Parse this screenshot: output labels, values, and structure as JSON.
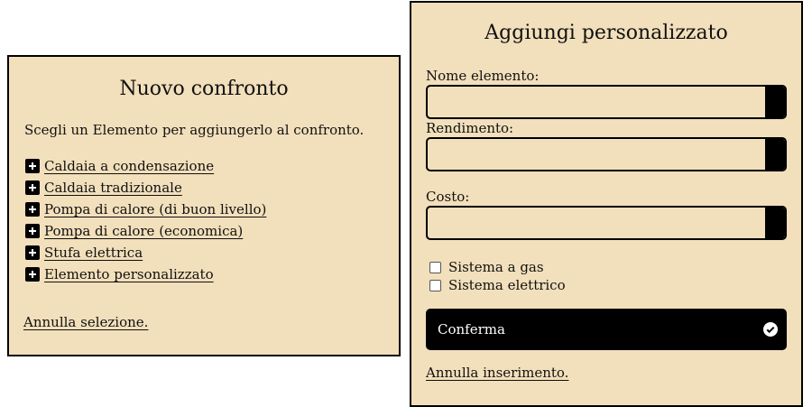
{
  "left_panel": {
    "title": "Nuovo confronto",
    "intro": "Scegli un Elemento per aggiungerlo al confronto.",
    "items": [
      {
        "label": "Caldaia a condensazione",
        "icon": "plus-icon"
      },
      {
        "label": "Caldaia tradizionale",
        "icon": "plus-icon"
      },
      {
        "label": "Pompa di calore (di buon livello)",
        "icon": "plus-icon"
      },
      {
        "label": "Pompa di calore (economica)",
        "icon": "plus-icon"
      },
      {
        "label": "Stufa elettrica",
        "icon": "plus-icon"
      },
      {
        "label": "Elemento personalizzato",
        "icon": "plus-icon"
      }
    ],
    "cancel_label": "Annulla selezione."
  },
  "right_panel": {
    "title": "Aggiungi personalizzato",
    "fields": {
      "name": {
        "label": "Nome elemento:",
        "value": ""
      },
      "efficiency": {
        "label": "Rendimento:",
        "value": ""
      },
      "cost": {
        "label": "Costo:",
        "value": ""
      }
    },
    "checkboxes": [
      {
        "label": "Sistema a gas",
        "checked": false
      },
      {
        "label": "Sistema elettrico",
        "checked": false
      }
    ],
    "confirm_label": "Conferma",
    "cancel_label": "Annulla inserimento."
  },
  "colors": {
    "panel_background": "#f2dfbb",
    "border": "#000000",
    "button_background": "#000000",
    "button_text": "#ffffff"
  }
}
